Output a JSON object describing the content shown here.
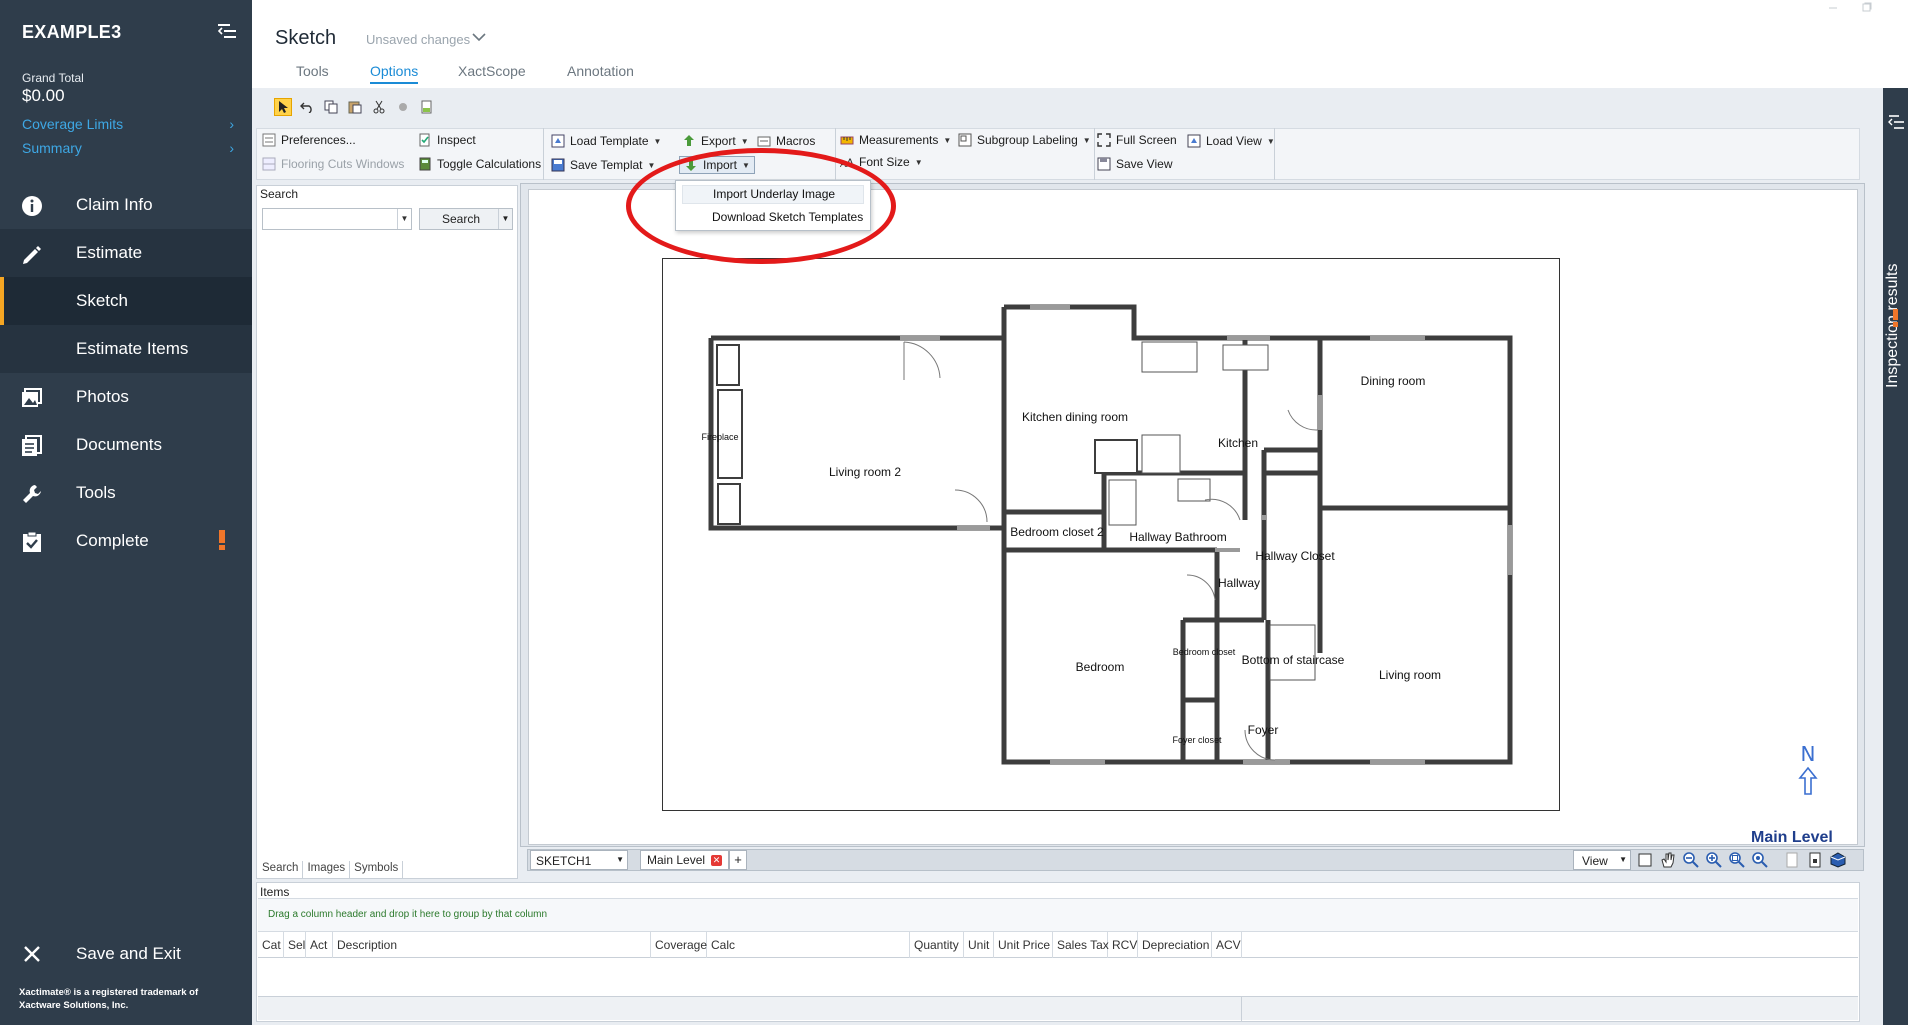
{
  "app": {
    "project_title": "EXAMPLE3",
    "grand_total_label": "Grand Total",
    "grand_total_value": "$0.00",
    "links": [
      {
        "label": "Coverage Limits",
        "chevron": "›"
      },
      {
        "label": "Summary",
        "chevron": "›"
      }
    ],
    "nav": [
      {
        "label": "Claim Info",
        "icon": "info-icon"
      },
      {
        "label": "Estimate",
        "icon": "pencil-icon"
      },
      {
        "label": "Sketch",
        "icon": ""
      },
      {
        "label": "Estimate Items",
        "icon": ""
      },
      {
        "label": "Photos",
        "icon": "photos-icon"
      },
      {
        "label": "Documents",
        "icon": "documents-icon"
      },
      {
        "label": "Tools",
        "icon": "wrench-icon"
      },
      {
        "label": "Complete",
        "icon": "checklist-icon",
        "alert": "!"
      }
    ],
    "save_exit": "Save and Exit",
    "footer_line1": "Xactimate® is a registered trademark of",
    "footer_line2": "Xactware Solutions, Inc."
  },
  "header": {
    "title": "Sketch",
    "status": "Unsaved changes",
    "tabs": [
      "Tools",
      "Options",
      "XactScope",
      "Annotation"
    ],
    "active_tab": "Options"
  },
  "right_rail": {
    "label": "Inspection results",
    "alert": "!"
  },
  "ribbon": {
    "preferences": "Preferences...",
    "flooring_cuts": "Flooring Cuts Windows",
    "inspect": "Inspect",
    "toggle_calc": "Toggle Calculations",
    "load_template": "Load Template",
    "save_template": "Save Templat",
    "export": "Export",
    "import": "Import",
    "macros": "Macros",
    "measurements": "Measurements",
    "font_size": "Font Size",
    "subgroup_labeling": "Subgroup Labeling",
    "full_screen": "Full Screen",
    "load_view": "Load View",
    "save_view": "Save View"
  },
  "import_menu": {
    "items": [
      "Import Underlay Image",
      "Download Sketch Templates"
    ]
  },
  "search_pane": {
    "title": "Search",
    "button": "Search",
    "tabs": [
      "Search",
      "Images",
      "Symbols"
    ]
  },
  "floor_plan": {
    "rooms": {
      "fireplace": "Fireplace",
      "living_room_2": "Living room 2",
      "kitchen_dining": "Kitchen dining room",
      "kitchen": "Kitchen",
      "dining_room": "Dining room",
      "bedroom_closet_2": "Bedroom closet 2",
      "hallway_bathroom": "Hallway Bathroom",
      "hallway_closet": "Hallway Closet",
      "hallway": "Hallway",
      "bedroom": "Bedroom",
      "bedroom_closet": "Bedroom closet",
      "bottom_staircase": "Bottom of staircase",
      "living_room": "Living room",
      "foyer": "Foyer",
      "foyer_closet": "Foyer closet"
    },
    "north_letter": "N",
    "level_label": "Main Level"
  },
  "canvas_bar": {
    "sketch_name": "SKETCH1",
    "level_tab": "Main Level",
    "add": "+",
    "view": "View"
  },
  "items_grid": {
    "title": "Items",
    "group_hint": "Drag a column header and drop it here to group by that column",
    "columns": [
      "Cat",
      "Sel",
      "Act",
      "Description",
      "Coverage",
      "Calc",
      "Quantity",
      "Unit",
      "Unit Price",
      "Sales Tax",
      "RCV",
      "Depreciation",
      "ACV"
    ]
  },
  "colors": {
    "sidebar": "#2f3d4b",
    "accent_blue": "#1a8bd6",
    "link_blue": "#3ea8e5",
    "alert_orange": "#f5a623",
    "highlight_red": "#e31a1a"
  }
}
